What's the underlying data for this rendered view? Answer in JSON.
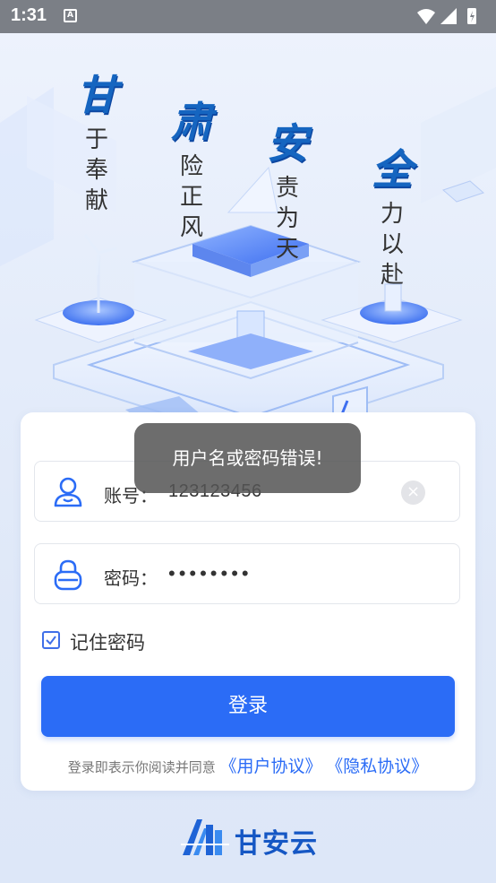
{
  "status_bar": {
    "time": "1:31",
    "notification_icon_letter": "A"
  },
  "slogans": [
    {
      "big": "甘",
      "small": "于奉献"
    },
    {
      "big": "肃",
      "small": "险正风"
    },
    {
      "big": "安",
      "small": "责为天"
    },
    {
      "big": "全",
      "small": "力以赴"
    }
  ],
  "login": {
    "account_label": "账号：",
    "account_value": "123123456",
    "password_label": "密码：",
    "password_value": "••••••••",
    "remember_label": "记住密码",
    "remember_checked": true,
    "login_button": "登录",
    "agreement_prefix": "登录即表示你阅读并同意",
    "user_agreement": "《用户协议》",
    "privacy_agreement": "《隐私协议》"
  },
  "toast": {
    "message": "用户名或密码错误!"
  },
  "brand": {
    "name": "甘安云"
  },
  "colors": {
    "accent": "#2b6cf6",
    "slogan_blue": "#1565c0",
    "status_bar": "#7b7f86"
  }
}
